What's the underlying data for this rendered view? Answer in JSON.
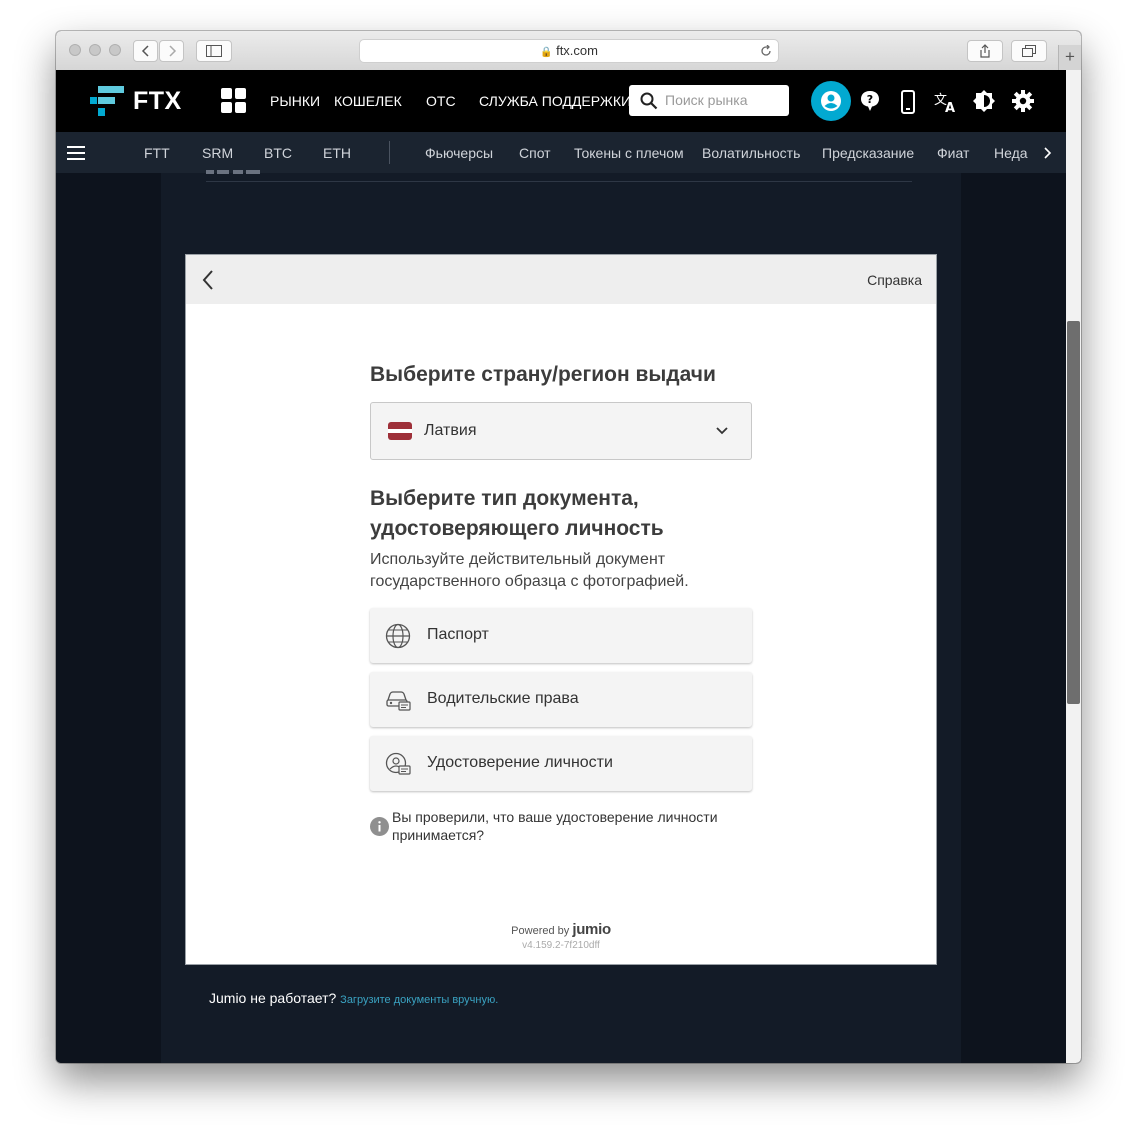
{
  "browser": {
    "url": "ftx.com"
  },
  "header": {
    "logo": "FTX",
    "nav": [
      "РЫНКИ",
      "КОШЕЛЕК",
      "OTC",
      "СЛУЖБА ПОДДЕРЖКИ"
    ],
    "search_placeholder": "Поиск рынка",
    "icons": [
      "account-icon",
      "help-icon",
      "mobile-icon",
      "translate-icon",
      "theme-icon",
      "settings-icon"
    ],
    "colors": {
      "accent": "#02a9d1",
      "header_bg": "#000000"
    }
  },
  "subnav": {
    "coins": [
      "FTT",
      "SRM",
      "BTC",
      "ETH"
    ],
    "categories": [
      "Фьючерсы",
      "Спот",
      "Токены с плечом",
      "Волатильность",
      "Предсказание",
      "Фиат",
      "Неда"
    ]
  },
  "jumio": {
    "help": "Справка",
    "country_heading": "Выберите страну/регион выдачи",
    "country": "Латвия",
    "doc_heading": "Выберите тип документа, удостоверяющего личность",
    "doc_description": "Используйте действительный документ государственного образца с фотографией.",
    "documents": [
      "Паспорт",
      "Водительские права",
      "Удостоверение личности"
    ],
    "info": "Вы проверили, что ваше удостоверение личности принимается?",
    "powered_by": "Powered by",
    "brand": "jumio",
    "version": "v4.159.2-7f210dff"
  },
  "footer": {
    "question": "Jumio не работает?",
    "link": "Загрузите документы вручную."
  }
}
